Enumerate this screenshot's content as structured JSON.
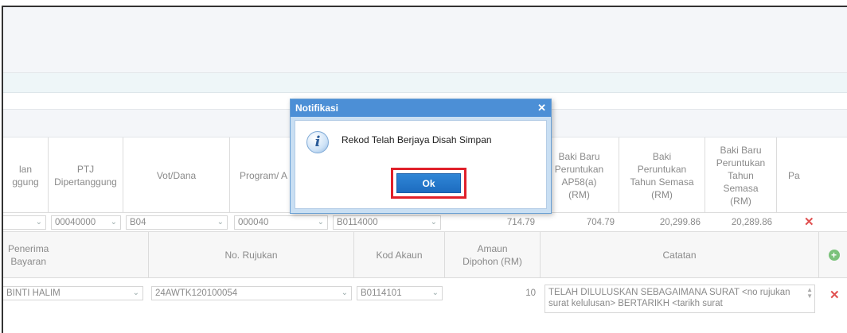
{
  "modal": {
    "title": "Notifikasi",
    "close": "✕",
    "message": "Rekod Telah Berjaya Disah Simpan",
    "ok_label": "Ok"
  },
  "table1": {
    "headers": [
      "lan\nggung",
      "PTJ\nDipertanggung",
      "Vot/Dana",
      "Program/ A",
      "",
      "",
      "Baki Baru\nPeruntukan\nAP58(a)\n(RM)",
      "Baki\nPeruntukan\nTahun Semasa\n(RM)",
      "Baki Baru\nPeruntukan\nTahun\nSemasa\n(RM)",
      "Pa"
    ],
    "row": {
      "ptj": "00040000",
      "vot": "B04",
      "program": "000040",
      "akaun": "B0114000",
      "val1": "714.79",
      "val2": "704.79",
      "val3": "20,299.86",
      "val4": "20,289.86"
    }
  },
  "table2": {
    "headers": [
      "Penerima\nBayaran",
      "No. Rujukan",
      "Kod Akaun",
      "Amaun\nDipohon (RM)",
      "Catatan"
    ],
    "row": {
      "penerima": "BINTI HALIM",
      "rujukan": "24AWTK120100054",
      "kod_akaun": "B0114101",
      "amaun": "10",
      "catatan": "TELAH DILULUSKAN SEBAGAIMANA SURAT <no rujukan surat kelulusan> BERTARIKH <tarikh surat"
    }
  },
  "icons": {
    "close": "close-icon",
    "add": "add-circle-icon",
    "delete": "delete-x-icon",
    "info": "info-icon",
    "dropdown": "chevron-down-icon"
  },
  "colors": {
    "modal_title_bg": "#4c8fd6",
    "ok_button": "#1d6cc0",
    "highlight_border": "#e0202a",
    "delete": "#e05050",
    "add": "#7bc27b"
  }
}
